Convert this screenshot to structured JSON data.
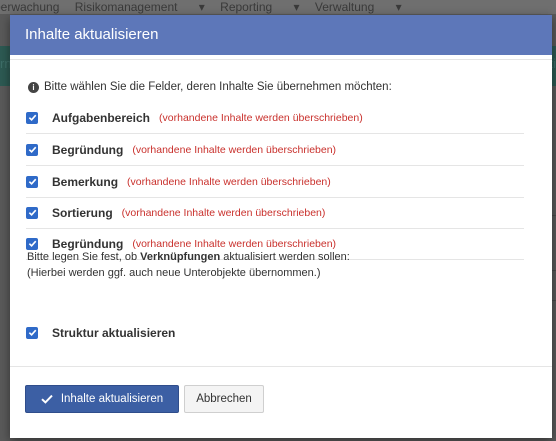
{
  "background": {
    "nav_items": [
      "berwachung",
      "Risikomanagement",
      "Reporting",
      "Verwaltung"
    ],
    "right_fragment_1": "rn",
    "right_fragment_2": "ti"
  },
  "dialog": {
    "title": "Inhalte aktualisieren",
    "hint": "Bitte wählen Sie die Felder, deren Inhalte Sie übernehmen möchten:",
    "fields": [
      {
        "label": "Aufgabenbereich",
        "note": "(vorhandene Inhalte werden überschrieben)",
        "checked": true
      },
      {
        "label": "Begründung",
        "note": "(vorhandene Inhalte werden überschrieben)",
        "checked": true
      },
      {
        "label": "Bemerkung",
        "note": "(vorhandene Inhalte werden überschrieben)",
        "checked": true
      },
      {
        "label": "Sortierung",
        "note": "(vorhandene Inhalte werden überschrieben)",
        "checked": true
      },
      {
        "label": "Begründung",
        "note": "(vorhandene Inhalte werden überschrieben)",
        "checked": true
      }
    ],
    "links_prefix": "Bitte legen Sie fest, ob ",
    "links_bold": "Verknüpfungen",
    "links_suffix": " aktualisiert werden sollen:",
    "links_sub": "(Hierbei werden ggf. auch neue Unterobjekte übernommen.)",
    "structure_label": "Struktur aktualisieren",
    "structure_checked": true,
    "primary_button": "Inhalte aktualisieren",
    "cancel_button": "Abbrechen"
  },
  "colors": {
    "header": "#5d77b9",
    "primary": "#3c5fa4",
    "checkbox": "#2f6ac8",
    "warning_text": "#c9302c"
  }
}
